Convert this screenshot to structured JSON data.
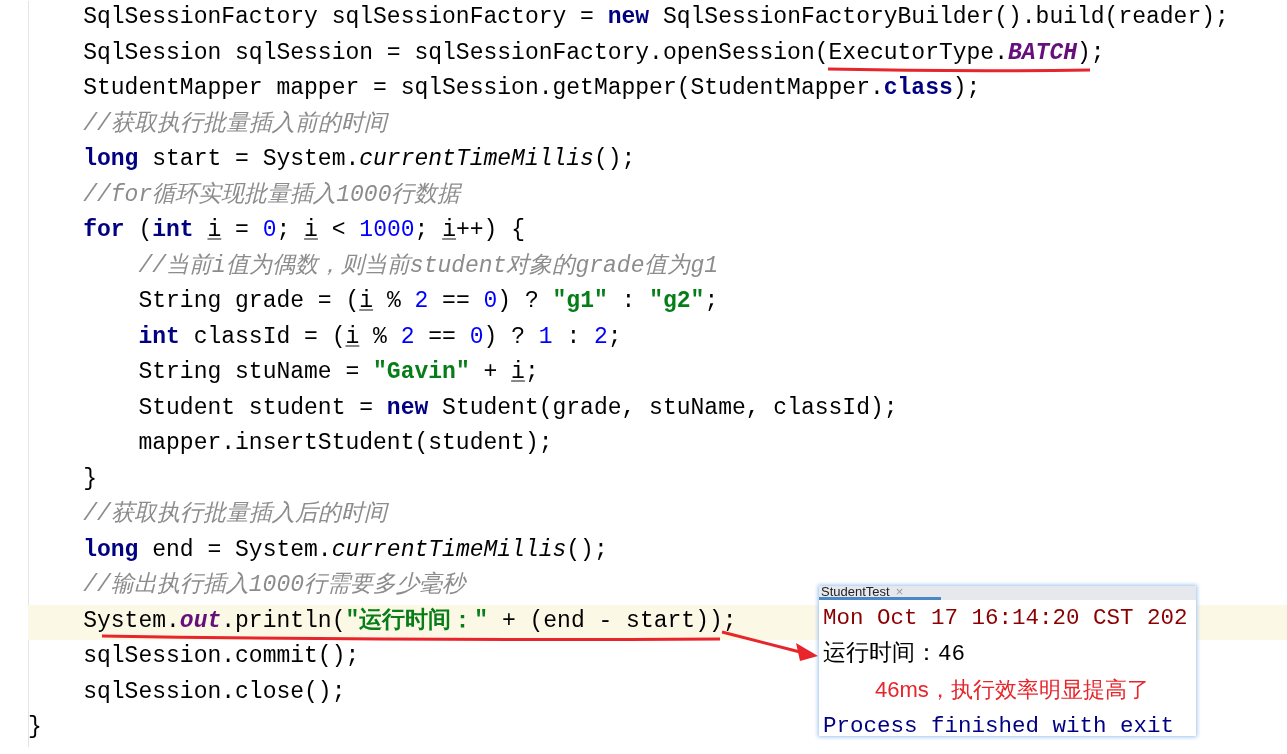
{
  "editor": {
    "lines": [
      {
        "highlighted": false,
        "tokens": [
          {
            "kind": "plain",
            "text": "    SqlSessionFactory sqlSessionFactory = "
          },
          {
            "kind": "keyword",
            "text": "new"
          },
          {
            "kind": "plain",
            "text": " SqlSessionFactoryBuilder().build(reader);"
          }
        ]
      },
      {
        "highlighted": false,
        "tokens": [
          {
            "kind": "plain",
            "text": "    SqlSession sqlSession = sqlSessionFactory.openSession(ExecutorType."
          },
          {
            "kind": "field",
            "text": "BATCH"
          },
          {
            "kind": "plain",
            "text": ");"
          }
        ]
      },
      {
        "highlighted": false,
        "tokens": [
          {
            "kind": "plain",
            "text": "    StudentMapper mapper = sqlSession.getMapper(StudentMapper."
          },
          {
            "kind": "keyword",
            "text": "class"
          },
          {
            "kind": "plain",
            "text": ");"
          }
        ]
      },
      {
        "highlighted": false,
        "tokens": [
          {
            "kind": "comment",
            "text": "    //获取执行批量插入前的时间"
          }
        ]
      },
      {
        "highlighted": false,
        "tokens": [
          {
            "kind": "keyword",
            "text": "    long"
          },
          {
            "kind": "plain",
            "text": " start = System."
          },
          {
            "kind": "static",
            "text": "currentTimeMillis"
          },
          {
            "kind": "plain",
            "text": "();"
          }
        ]
      },
      {
        "highlighted": false,
        "tokens": [
          {
            "kind": "comment",
            "text": "    //for循环实现批量插入1000行数据"
          }
        ]
      },
      {
        "highlighted": false,
        "tokens": [
          {
            "kind": "keyword",
            "text": "    for"
          },
          {
            "kind": "plain",
            "text": " ("
          },
          {
            "kind": "keyword",
            "text": "int "
          },
          {
            "kind": "var",
            "text": "i"
          },
          {
            "kind": "plain",
            "text": " = "
          },
          {
            "kind": "number",
            "text": "0"
          },
          {
            "kind": "plain",
            "text": "; "
          },
          {
            "kind": "var",
            "text": "i"
          },
          {
            "kind": "plain",
            "text": " < "
          },
          {
            "kind": "number",
            "text": "1000"
          },
          {
            "kind": "plain",
            "text": "; "
          },
          {
            "kind": "var",
            "text": "i"
          },
          {
            "kind": "plain",
            "text": "++) {"
          }
        ]
      },
      {
        "highlighted": false,
        "tokens": [
          {
            "kind": "comment",
            "text": "        //当前i值为偶数，则当前student对象的grade值为g1"
          }
        ]
      },
      {
        "highlighted": false,
        "tokens": [
          {
            "kind": "plain",
            "text": "        String grade = ("
          },
          {
            "kind": "var",
            "text": "i"
          },
          {
            "kind": "plain",
            "text": " % "
          },
          {
            "kind": "number",
            "text": "2"
          },
          {
            "kind": "plain",
            "text": " == "
          },
          {
            "kind": "number",
            "text": "0"
          },
          {
            "kind": "plain",
            "text": ") ? "
          },
          {
            "kind": "string",
            "text": "\"g1\""
          },
          {
            "kind": "plain",
            "text": " : "
          },
          {
            "kind": "string",
            "text": "\"g2\""
          },
          {
            "kind": "plain",
            "text": ";"
          }
        ]
      },
      {
        "highlighted": false,
        "tokens": [
          {
            "kind": "keyword",
            "text": "        int"
          },
          {
            "kind": "plain",
            "text": " classId = ("
          },
          {
            "kind": "var",
            "text": "i"
          },
          {
            "kind": "plain",
            "text": " % "
          },
          {
            "kind": "number",
            "text": "2"
          },
          {
            "kind": "plain",
            "text": " == "
          },
          {
            "kind": "number",
            "text": "0"
          },
          {
            "kind": "plain",
            "text": ") ? "
          },
          {
            "kind": "number",
            "text": "1"
          },
          {
            "kind": "plain",
            "text": " : "
          },
          {
            "kind": "number",
            "text": "2"
          },
          {
            "kind": "plain",
            "text": ";"
          }
        ]
      },
      {
        "highlighted": false,
        "tokens": [
          {
            "kind": "plain",
            "text": "        String stuName = "
          },
          {
            "kind": "string",
            "text": "\"Gavin\""
          },
          {
            "kind": "plain",
            "text": " + "
          },
          {
            "kind": "var",
            "text": "i"
          },
          {
            "kind": "plain",
            "text": ";"
          }
        ]
      },
      {
        "highlighted": false,
        "tokens": [
          {
            "kind": "plain",
            "text": "        Student student = "
          },
          {
            "kind": "keyword",
            "text": "new"
          },
          {
            "kind": "plain",
            "text": " Student(grade, stuName, classId);"
          }
        ]
      },
      {
        "highlighted": false,
        "tokens": [
          {
            "kind": "plain",
            "text": "        mapper.insertStudent(student);"
          }
        ]
      },
      {
        "highlighted": false,
        "tokens": [
          {
            "kind": "plain",
            "text": "    }"
          }
        ]
      },
      {
        "highlighted": false,
        "tokens": [
          {
            "kind": "comment",
            "text": "    //获取执行批量插入后的时间"
          }
        ]
      },
      {
        "highlighted": false,
        "tokens": [
          {
            "kind": "keyword",
            "text": "    long"
          },
          {
            "kind": "plain",
            "text": " end = System."
          },
          {
            "kind": "static",
            "text": "currentTimeMillis"
          },
          {
            "kind": "plain",
            "text": "();"
          }
        ]
      },
      {
        "highlighted": false,
        "tokens": [
          {
            "kind": "comment",
            "text": "    //输出执行插入1000行需要多少毫秒"
          }
        ]
      },
      {
        "highlighted": true,
        "tokens": [
          {
            "kind": "plain",
            "text": "    System."
          },
          {
            "kind": "field",
            "text": "out"
          },
          {
            "kind": "plain",
            "text": ".println("
          },
          {
            "kind": "string",
            "text": "\"运行时间：\""
          },
          {
            "kind": "plain",
            "text": " + (end - start));"
          }
        ]
      },
      {
        "highlighted": false,
        "tokens": [
          {
            "kind": "plain",
            "text": "    sqlSession.commit();"
          }
        ]
      },
      {
        "highlighted": false,
        "tokens": [
          {
            "kind": "plain",
            "text": "    sqlSession.close();"
          }
        ]
      },
      {
        "highlighted": false,
        "tokens": [
          {
            "kind": "plain",
            "text": "}"
          }
        ]
      }
    ]
  },
  "console": {
    "tab": {
      "label": "StudentTest",
      "close": "×",
      "selected": true
    },
    "lines": [
      {
        "kind": "date",
        "text": "Mon Oct 17 16:14:20 CST 202"
      },
      {
        "kind": "output",
        "text": "运行时间：46"
      },
      {
        "kind": "note",
        "text": "46ms，执行效率明显提高了"
      },
      {
        "kind": "exit",
        "text": "Process finished with exit"
      }
    ]
  }
}
